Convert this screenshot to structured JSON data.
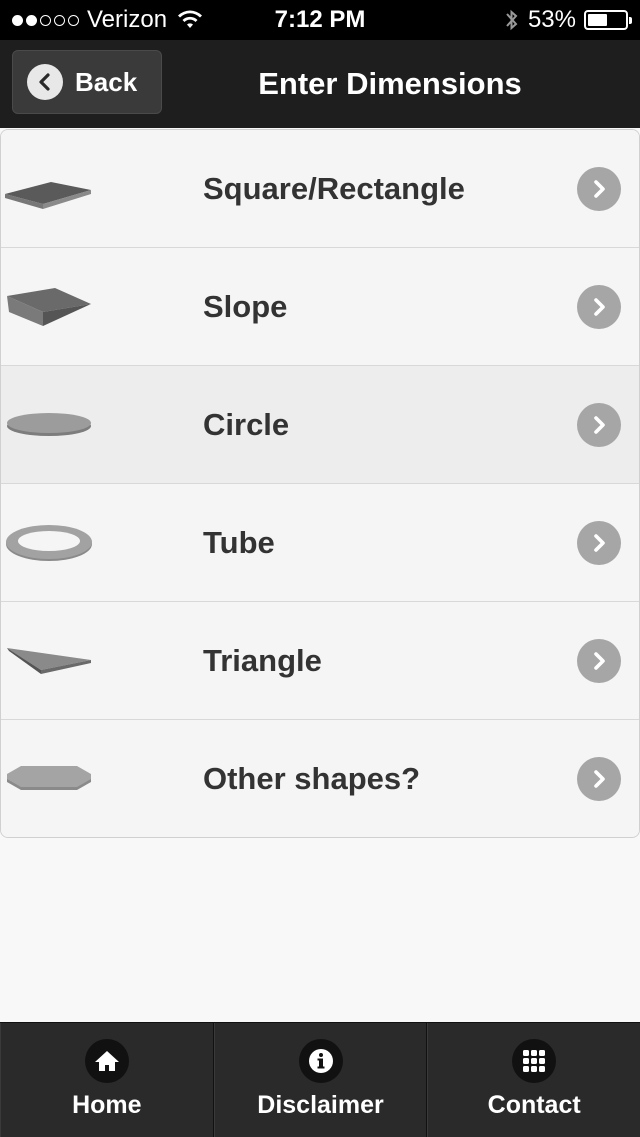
{
  "status_bar": {
    "carrier": "Verizon",
    "time": "7:12 PM",
    "battery": "53%",
    "battery_level": 0.53,
    "signal_bars_filled": 2,
    "signal_bars_total": 5
  },
  "nav": {
    "back_label": "Back",
    "title": "Enter Dimensions"
  },
  "shapes": [
    {
      "label": "Square/Rectangle",
      "icon": "square-slab-icon"
    },
    {
      "label": "Slope",
      "icon": "slope-slab-icon"
    },
    {
      "label": "Circle",
      "icon": "circle-slab-icon"
    },
    {
      "label": "Tube",
      "icon": "tube-ring-icon"
    },
    {
      "label": "Triangle",
      "icon": "triangle-slab-icon"
    },
    {
      "label": "Other shapes?",
      "icon": "octagon-slab-icon"
    }
  ],
  "tabs": [
    {
      "label": "Home",
      "icon": "home-icon"
    },
    {
      "label": "Disclaimer",
      "icon": "info-icon"
    },
    {
      "label": "Contact",
      "icon": "grid-icon"
    }
  ],
  "colors": {
    "nav_background": "#1e1e1e",
    "tab_background": "#2a2a2a",
    "list_background": "#f5f5f5",
    "chevron": "#a6a6a6",
    "text": "#333333"
  }
}
